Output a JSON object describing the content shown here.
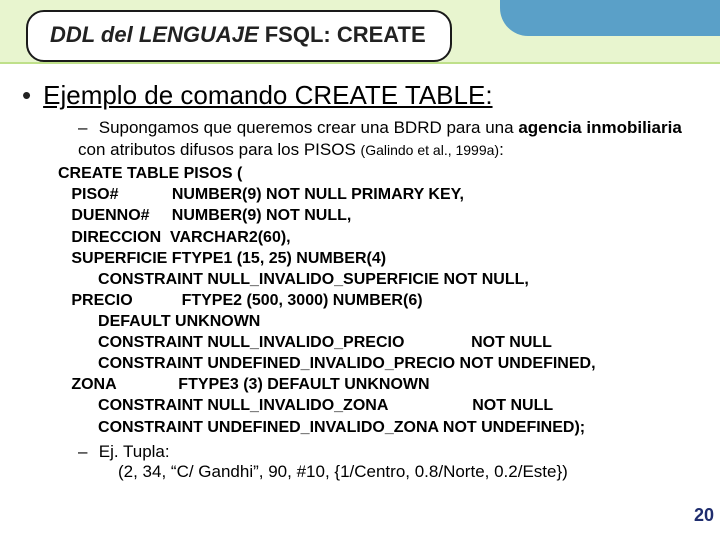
{
  "title": {
    "ddl": "DDL del  LENGUAJE",
    "rest": "  FSQL: CREATE"
  },
  "heading": "Ejemplo de comando CREATE TABLE:",
  "intro_pre": "Supongamos que queremos crear una BDRD para una ",
  "intro_bold1": "agencia inmobiliaria",
  "intro_mid": " con atributos difusos para los PISOS ",
  "cite": "(Galindo et al., 1999a)",
  "intro_colon": ":",
  "code": "CREATE TABLE PISOS (\n   PISO#            NUMBER(9) NOT NULL PRIMARY KEY,\n   DUENNO#     NUMBER(9) NOT NULL,\n   DIRECCION  VARCHAR2(60),\n   SUPERFICIE FTYPE1 (15, 25) NUMBER(4)\n         CONSTRAINT NULL_INVALIDO_SUPERFICIE NOT NULL,\n   PRECIO           FTYPE2 (500, 3000) NUMBER(6)\n         DEFAULT UNKNOWN\n         CONSTRAINT NULL_INVALIDO_PRECIO               NOT NULL\n         CONSTRAINT UNDEFINED_INVALIDO_PRECIO NOT UNDEFINED,\n   ZONA              FTYPE3 (3) DEFAULT UNKNOWN\n         CONSTRAINT NULL_INVALIDO_ZONA                   NOT NULL\n         CONSTRAINT UNDEFINED_INVALIDO_ZONA NOT UNDEFINED);",
  "ej_label": "Ej. Tupla:",
  "tupla": "(2, 34, “C/ Gandhi”, 90, #10, {1/Centro, 0.8/Norte, 0.2/Este})",
  "page": "20"
}
